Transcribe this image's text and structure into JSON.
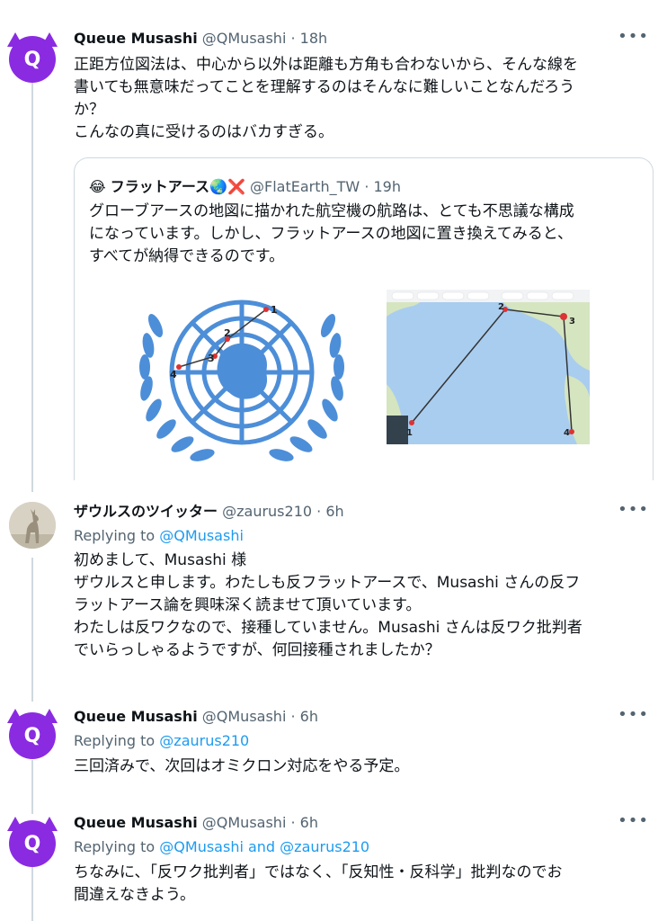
{
  "tweets": [
    {
      "name": "Queue Musashi",
      "handle": "@QMusashi",
      "time": "18h",
      "text": [
        "正距方位図法は、中心から以外は距離も方角も合わないから、そんな線を",
        "書いても無意味だってことを理解するのはそんなに難しいことなんだろう",
        "か？",
        "こんなの真に受けるのはバカすぎる。"
      ]
    },
    {
      "name": "ザウルスのツイッター",
      "handle": "@zaurus210",
      "time": "6h",
      "replying_label": "Replying to",
      "replying_to": "@QMusashi",
      "text": [
        "初めまして、Musashi 様",
        "ザウルスと申します。わたしも反フラットアースで、Musashi さんの反フ",
        "ラットアース論を興味深く読ませて頂いています。",
        "わたしは反ワクなので、接種していません。Musashi さんは反ワク批判者",
        "でいらっしゃるようですが、何回接種されましたか？"
      ]
    },
    {
      "name": "Queue Musashi",
      "handle": "@QMusashi",
      "time": "6h",
      "replying_label": "Replying to",
      "replying_to": "@zaurus210",
      "text": [
        "三回済みで、次回はオミクロン対応をやる予定。"
      ]
    },
    {
      "name": "Queue Musashi",
      "handle": "@QMusashi",
      "time": "6h",
      "replying_label": "Replying to",
      "replying_to": "@QMusashi and @zaurus210",
      "text": [
        "ちなみに、「反ワク批判者」ではなく、「反知性・反科学」批判なのでお",
        "間違えなきよう。"
      ]
    }
  ],
  "quoted": {
    "emoji": "😂",
    "name": "フラットアース",
    "badge_globe": "🌏",
    "badge_cross": "❌",
    "handle": "@FlatEarth_TW",
    "time": "19h",
    "text": [
      "グローブアースの地図に描かれた航空機の航路は、とても不思議な構成",
      "になっています。しかし、フラットアースの地図に置き換えてみると、",
      "すべてが納得できるのです。"
    ],
    "un_map_labels": [
      "1",
      "2",
      "3",
      "4"
    ],
    "globe_map_labels": [
      "1",
      "2",
      "3",
      "4"
    ]
  },
  "ui": {
    "separator": "·",
    "more_icon": "•••",
    "avatar_letter": "Q"
  },
  "colors": {
    "link": "#1d9bf0",
    "secondary": "#536471",
    "thread_line": "#cfd9de",
    "avatar_purple": "#8a2be2",
    "un_blue": "#4d8ed8",
    "map_ocean": "#a9cdef",
    "map_land": "#d5e5c0"
  }
}
